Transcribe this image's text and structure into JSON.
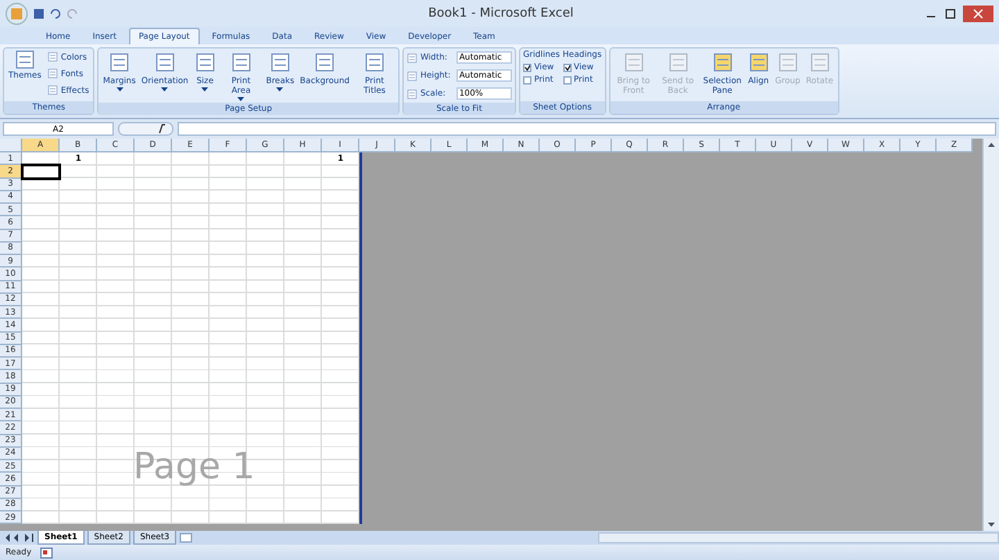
{
  "window": {
    "title": "Book1 - Microsoft Excel"
  },
  "tabs": [
    {
      "label": "Home",
      "selected": false
    },
    {
      "label": "Insert",
      "selected": false
    },
    {
      "label": "Page Layout",
      "selected": true
    },
    {
      "label": "Formulas",
      "selected": false
    },
    {
      "label": "Data",
      "selected": false
    },
    {
      "label": "Review",
      "selected": false
    },
    {
      "label": "View",
      "selected": false
    },
    {
      "label": "Developer",
      "selected": false
    },
    {
      "label": "Team",
      "selected": false
    }
  ],
  "ribbon": {
    "themes": {
      "label": "Themes",
      "big": "Themes",
      "small": [
        "Colors",
        "Fonts",
        "Effects"
      ]
    },
    "page_setup": {
      "label": "Page Setup",
      "buttons": [
        {
          "label": "Margins",
          "dropdown": true
        },
        {
          "label": "Orientation",
          "dropdown": true
        },
        {
          "label": "Size",
          "dropdown": true
        },
        {
          "label": "Print Area",
          "dropdown": true
        },
        {
          "label": "Breaks",
          "dropdown": true
        },
        {
          "label": "Background",
          "dropdown": false
        },
        {
          "label": "Print Titles",
          "dropdown": false
        }
      ]
    },
    "scale_to_fit": {
      "label": "Scale to Fit",
      "fields": [
        {
          "label": "Width:",
          "value": "Automatic"
        },
        {
          "label": "Height:",
          "value": "Automatic"
        },
        {
          "label": "Scale:",
          "value": "100%"
        }
      ]
    },
    "sheet_options": {
      "label": "Sheet Options",
      "columns": [
        {
          "heading": "Gridlines",
          "options": [
            {
              "label": "View",
              "checked": true
            },
            {
              "label": "Print",
              "checked": false
            }
          ]
        },
        {
          "heading": "Headings",
          "options": [
            {
              "label": "View",
              "checked": true
            },
            {
              "label": "Print",
              "checked": false
            }
          ]
        }
      ]
    },
    "arrange": {
      "label": "Arrange",
      "buttons": [
        {
          "label": "Bring to Front",
          "disabled": true
        },
        {
          "label": "Send to Back",
          "disabled": true
        },
        {
          "label": "Selection Pane",
          "disabled": false
        },
        {
          "label": "Align",
          "disabled": false
        },
        {
          "label": "Group",
          "disabled": true
        },
        {
          "label": "Rotate",
          "disabled": true
        }
      ]
    }
  },
  "name_box": "A2",
  "columns": [
    {
      "label": "A",
      "selected": true,
      "in_print_area": true
    },
    {
      "label": "B",
      "selected": false,
      "in_print_area": true,
      "row_1": "1"
    },
    {
      "label": "C",
      "selected": false,
      "in_print_area": true
    },
    {
      "label": "D",
      "selected": false,
      "in_print_area": true
    },
    {
      "label": "E",
      "selected": false,
      "in_print_area": true
    },
    {
      "label": "F",
      "selected": false,
      "in_print_area": true
    },
    {
      "label": "G",
      "selected": false,
      "in_print_area": true
    },
    {
      "label": "H",
      "selected": false,
      "in_print_area": true
    },
    {
      "label": "I",
      "selected": false,
      "in_print_area": true,
      "row_1": "1"
    },
    {
      "label": "J",
      "selected": false,
      "in_print_area": false
    },
    {
      "label": "K",
      "selected": false,
      "in_print_area": false
    },
    {
      "label": "L",
      "selected": false,
      "in_print_area": false
    },
    {
      "label": "M",
      "selected": false,
      "in_print_area": false
    },
    {
      "label": "N",
      "selected": false,
      "in_print_area": false
    },
    {
      "label": "O",
      "selected": false,
      "in_print_area": false
    },
    {
      "label": "P",
      "selected": false,
      "in_print_area": false
    },
    {
      "label": "Q",
      "selected": false,
      "in_print_area": false
    },
    {
      "label": "R",
      "selected": false,
      "in_print_area": false
    },
    {
      "label": "S",
      "selected": false,
      "in_print_area": false
    },
    {
      "label": "T",
      "selected": false,
      "in_print_area": false
    },
    {
      "label": "U",
      "selected": false,
      "in_print_area": false
    },
    {
      "label": "V",
      "selected": false,
      "in_print_area": false
    },
    {
      "label": "W",
      "selected": false,
      "in_print_area": false
    },
    {
      "label": "X",
      "selected": false,
      "in_print_area": false
    },
    {
      "label": "Y",
      "selected": false,
      "in_print_area": false
    },
    {
      "label": "Z",
      "selected": false,
      "in_print_area": false
    }
  ],
  "rows": [
    {
      "label": "1",
      "selected": false
    },
    {
      "label": "2",
      "selected": true
    },
    {
      "label": "3",
      "selected": false
    },
    {
      "label": "4",
      "selected": false
    },
    {
      "label": "5",
      "selected": false
    },
    {
      "label": "6",
      "selected": false
    },
    {
      "label": "7",
      "selected": false
    },
    {
      "label": "8",
      "selected": false
    },
    {
      "label": "9",
      "selected": false
    },
    {
      "label": "10",
      "selected": false
    },
    {
      "label": "11",
      "selected": false
    },
    {
      "label": "12",
      "selected": false
    },
    {
      "label": "13",
      "selected": false
    },
    {
      "label": "14",
      "selected": false
    },
    {
      "label": "15",
      "selected": false
    },
    {
      "label": "16",
      "selected": false
    },
    {
      "label": "17",
      "selected": false
    },
    {
      "label": "18",
      "selected": false
    },
    {
      "label": "19",
      "selected": false
    },
    {
      "label": "20",
      "selected": false
    },
    {
      "label": "21",
      "selected": false
    },
    {
      "label": "22",
      "selected": false
    },
    {
      "label": "23",
      "selected": false
    },
    {
      "label": "24",
      "selected": false
    },
    {
      "label": "25",
      "selected": false
    },
    {
      "label": "26",
      "selected": false
    },
    {
      "label": "27",
      "selected": false
    },
    {
      "label": "28",
      "selected": false
    },
    {
      "label": "29",
      "selected": false
    }
  ],
  "page_label": "Page 1",
  "sheets": [
    {
      "label": "Sheet1",
      "selected": true
    },
    {
      "label": "Sheet2",
      "selected": false
    },
    {
      "label": "Sheet3",
      "selected": false
    }
  ],
  "status_bar": {
    "text": "Ready"
  }
}
